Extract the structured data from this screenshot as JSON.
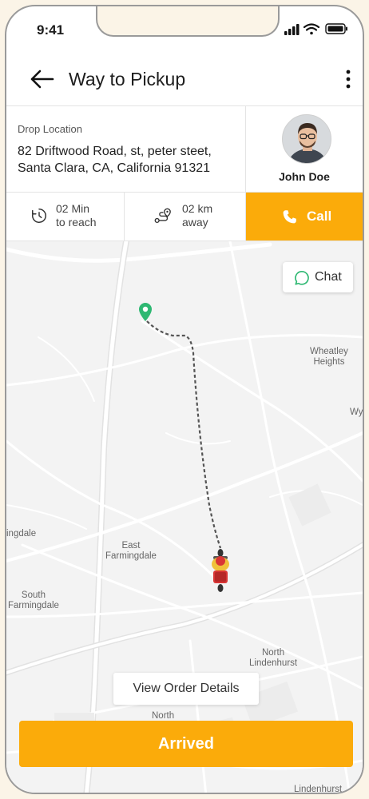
{
  "status_bar": {
    "time": "9:41",
    "icons": [
      "signal-icon",
      "wifi-icon",
      "battery-icon"
    ]
  },
  "header": {
    "title": "Way to Pickup",
    "back_icon": "arrow-left-icon",
    "menu_icon": "more-vertical-icon"
  },
  "drop": {
    "label": "Drop Location",
    "address_line1": "82  Driftwood Road, st, peter steet,",
    "address_line2": "Santa Clara, CA, California 91321"
  },
  "customer": {
    "name": "John Doe"
  },
  "eta": {
    "line1": "02 Min",
    "line2": "to reach",
    "icon": "clock-icon"
  },
  "distance": {
    "line1": "02 km",
    "line2": "away",
    "icon": "route-icon"
  },
  "call": {
    "label": "Call",
    "icon": "phone-icon"
  },
  "chat": {
    "label": "Chat",
    "icon": "chat-bubble-icon"
  },
  "map": {
    "labels": {
      "wheatley_1": "Wheatley",
      "wheatley_2": "Heights",
      "wy": "Wy",
      "ingdale": "ingdale",
      "east_1": "East",
      "east_2": "Farmingdale",
      "south_1": "South",
      "south_2": "Farmingdale",
      "north_lind_1": "North",
      "north_lind_2": "Lindenhurst",
      "north": "North",
      "lindenhurst": "Lindenhurst"
    },
    "pickup_marker_icon": "map-pin-icon",
    "rider_icon": "delivery-rider-icon"
  },
  "actions": {
    "view_order": "View Order Details",
    "arrived": "Arrived"
  },
  "colors": {
    "accent": "#fbab0a",
    "pin": "#2eb872",
    "route": "#555555"
  }
}
